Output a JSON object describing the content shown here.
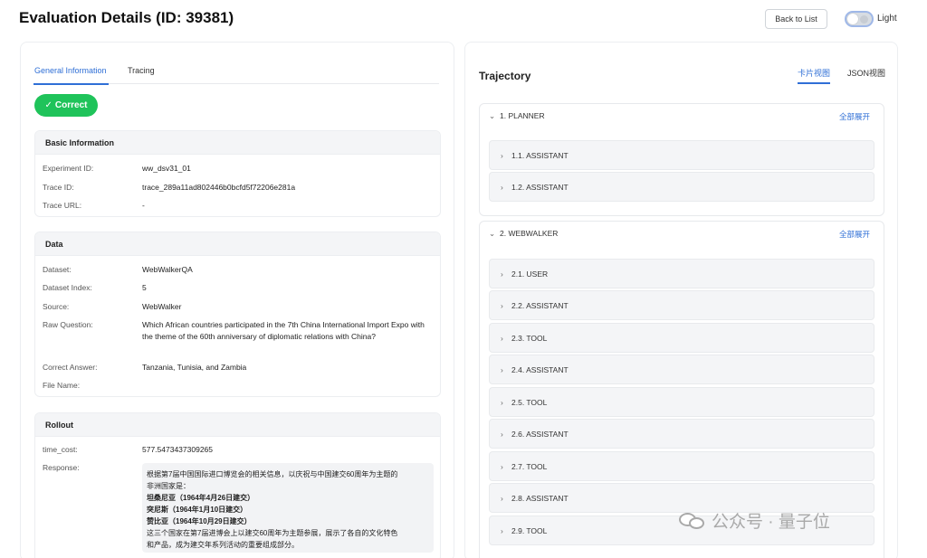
{
  "header": {
    "title": "Evaluation Details (ID: 39381)",
    "back_label": "Back to List",
    "theme_label": "Light"
  },
  "left": {
    "tabs": [
      "General Information",
      "Tracing"
    ],
    "status": "Correct",
    "basic": {
      "title": "Basic Information",
      "rows": [
        {
          "k": "Experiment ID:",
          "v": "ww_dsv31_01"
        },
        {
          "k": "Trace ID:",
          "v": "trace_289a11ad802446b0bcfd5f72206e281a"
        },
        {
          "k": "Trace URL:",
          "v": "-"
        }
      ]
    },
    "data": {
      "title": "Data",
      "rows": [
        {
          "k": "Dataset:",
          "v": "WebWalkerQA"
        },
        {
          "k": "Dataset Index:",
          "v": "5"
        },
        {
          "k": "Source:",
          "v": "WebWalker"
        },
        {
          "k": "Raw Question:",
          "v": "Which African countries participated in the 7th China International Import Expo with the theme of the 60th anniversary of diplomatic relations with China?"
        },
        {
          "k": "Correct Answer:",
          "v": "Tanzania, Tunisia, and Zambia"
        },
        {
          "k": "File Name:",
          "v": ""
        }
      ]
    },
    "rollout": {
      "title": "Rollout",
      "time_cost_label": "time_cost:",
      "time_cost": "577.5473437309265",
      "response_label": "Response:",
      "response_lines": [
        "根据第7届中国国际进口博览会的相关信息，以庆祝与中国建交60周年为主题的",
        "非洲国家是：",
        "坦桑尼亚（1964年4月26日建交）",
        "突尼斯（1964年1月10日建交）",
        "赞比亚（1964年10月29日建交）",
        "这三个国家在第7届进博会上以建交60周年为主题参展，展示了各自的文化特色",
        "和产品，成为建交年系列活动的重要组成部分。"
      ]
    }
  },
  "right": {
    "title": "Trajectory",
    "view_tabs": [
      "卡片视图",
      "JSON视图"
    ],
    "expand_all": "全部展开",
    "groups": [
      {
        "label": "1. PLANNER",
        "steps": [
          "1.1. ASSISTANT",
          "1.2. ASSISTANT"
        ]
      },
      {
        "label": "2. WEBWALKER",
        "steps": [
          "2.1. USER",
          "2.2. ASSISTANT",
          "2.3. TOOL",
          "2.4. ASSISTANT",
          "2.5. TOOL",
          "2.6. ASSISTANT",
          "2.7. TOOL",
          "2.8. ASSISTANT",
          "2.9. TOOL"
        ]
      }
    ]
  },
  "watermark": "公众号 · 量子位"
}
